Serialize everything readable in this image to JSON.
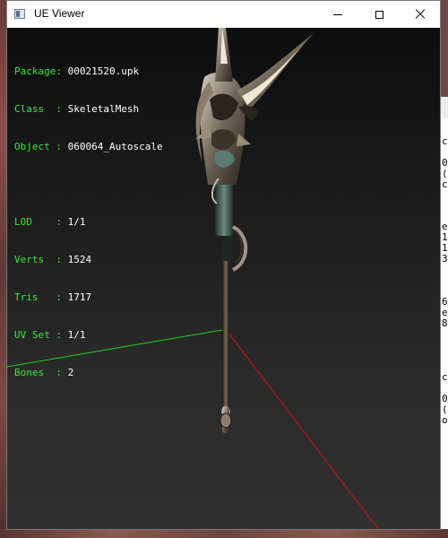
{
  "window": {
    "title": "UE Viewer",
    "icon": "ue-viewer-app-icon",
    "buttons": {
      "minimize_icon": "minimize-icon",
      "maximize_icon": "maximize-icon",
      "close_icon": "close-icon"
    }
  },
  "info": {
    "package_label": "Package:",
    "package_value": "00021520.upk",
    "class_label": "Class  :",
    "class_value": "SkeletalMesh",
    "object_label": "Object :",
    "object_value": "060064_Autoscale",
    "lod_label": "LOD    :",
    "lod_value": "1/1",
    "verts_label": "Verts  :",
    "verts_value": "1524",
    "tris_label": "Tris   :",
    "tris_value": "1717",
    "uvset_label": "UV Set :",
    "uvset_value": "1/1",
    "bones_label": "Bones  :",
    "bones_value": "2"
  },
  "background_window": {
    "fragments": [
      "c",
      "0",
      "(",
      "c",
      "e",
      "1",
      "1",
      "3",
      "6",
      "e",
      "8",
      "c",
      "0",
      "(",
      "o"
    ]
  },
  "colors": {
    "info_label": "#3ce83c",
    "info_value": "#ffffff",
    "axis_x": "#cc1010",
    "axis_y": "#20d020"
  }
}
